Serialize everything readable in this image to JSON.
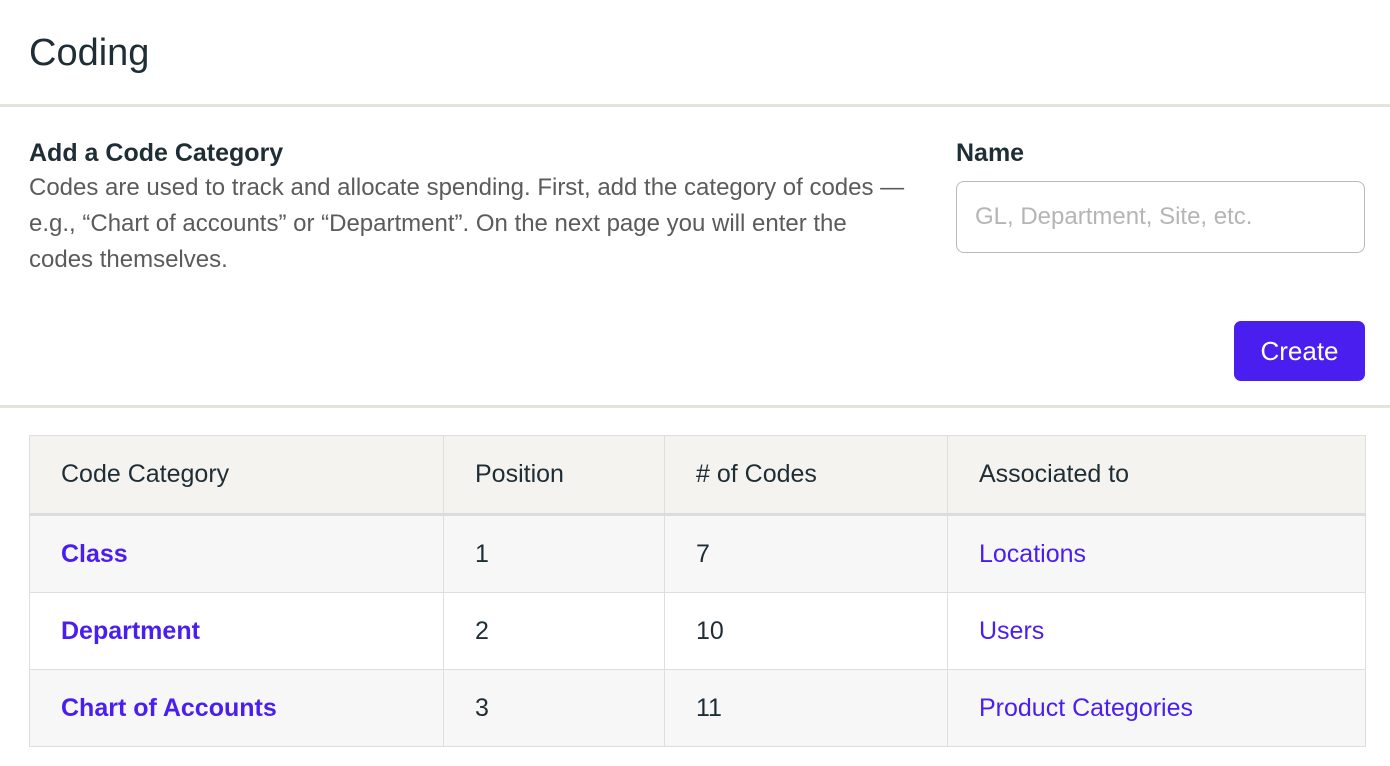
{
  "page": {
    "title": "Coding"
  },
  "form": {
    "heading": "Add a Code Category",
    "description": "Codes are used to track and allocate spending. First, add the category of codes — e.g., “Chart of accounts” or “Department”. On the next page you will enter the codes themselves.",
    "name_label": "Name",
    "name_value": "",
    "name_placeholder": "GL, Department, Site, etc.",
    "create_label": "Create"
  },
  "table": {
    "headers": [
      "Code Category",
      "Position",
      "# of Codes",
      "Associated to"
    ],
    "rows": [
      {
        "category": "Class",
        "position": "1",
        "codes": "7",
        "associated": "Locations"
      },
      {
        "category": "Department",
        "position": "2",
        "codes": "10",
        "associated": "Users"
      },
      {
        "category": "Chart of Accounts",
        "position": "3",
        "codes": "11",
        "associated": "Product Categories"
      }
    ]
  },
  "colors": {
    "accent": "#4b1ef0",
    "header_bg": "#f4f3ef",
    "divider": "#e4e4df"
  }
}
